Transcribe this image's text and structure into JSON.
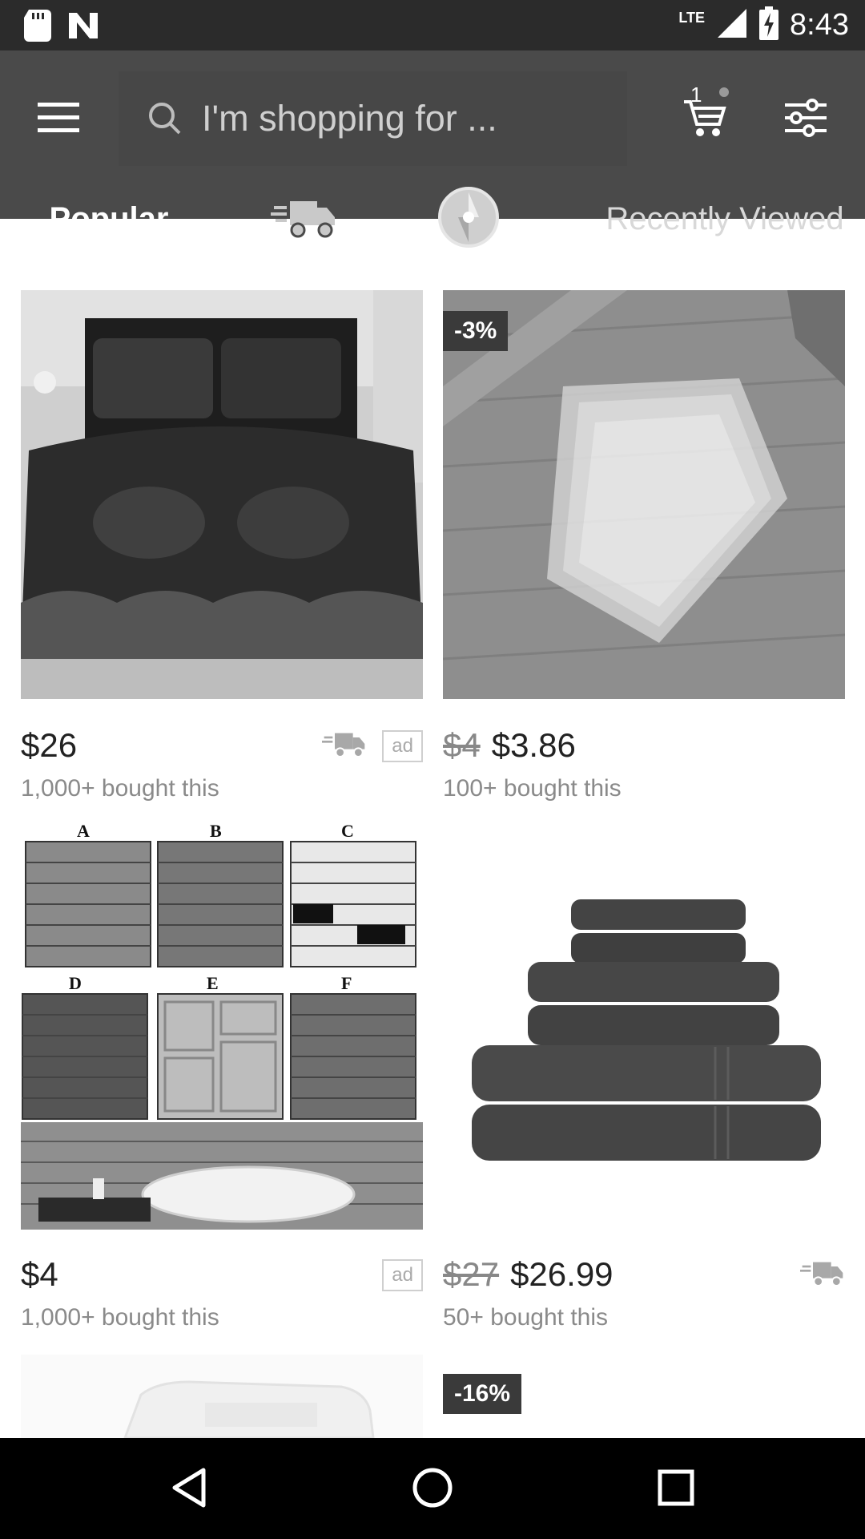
{
  "status_bar": {
    "time": "8:43",
    "network": "LTE",
    "icons": [
      "sd-card-icon",
      "n-logo-icon",
      "signal-icon",
      "battery-charging-icon"
    ]
  },
  "header": {
    "menu_icon": "menu-icon",
    "search": {
      "placeholder": "I'm shopping for ...",
      "icon": "search-icon"
    },
    "cart": {
      "count": "1",
      "icon": "cart-icon"
    },
    "filter_icon": "filter-icon"
  },
  "tabs": [
    {
      "label": "Popular",
      "selected": true
    },
    {
      "icon": "shipping-truck-icon"
    },
    {
      "icon": "deal-disc-icon"
    },
    {
      "label": "Recently Viewed"
    }
  ],
  "products": [
    {
      "name": "bedding-set",
      "price": "$26",
      "old_price": "",
      "bought": "1,000+ bought this",
      "ad": "ad",
      "fast_shipping": true,
      "discount": ""
    },
    {
      "name": "clear-bags",
      "price": "$3.86",
      "old_price": "$4",
      "bought": "100+ bought this",
      "ad": "",
      "fast_shipping": false,
      "discount": "-3%"
    },
    {
      "name": "wall-tiles",
      "price": "$4",
      "old_price": "",
      "bought": "1,000+ bought this",
      "ad": "ad",
      "fast_shipping": false,
      "discount": "",
      "tile_labels": [
        "A",
        "B",
        "C",
        "D",
        "E",
        "F"
      ]
    },
    {
      "name": "towels",
      "price": "$26.99",
      "old_price": "$27",
      "bought": "50+ bought this",
      "ad": "",
      "fast_shipping": true,
      "discount": ""
    },
    {
      "name": "next-left",
      "discount": ""
    },
    {
      "name": "next-right",
      "discount": "-16%"
    }
  ],
  "nav": {
    "back_icon": "back-icon",
    "home_icon": "home-icon",
    "recents_icon": "recents-icon"
  },
  "colors": {
    "status_bar": "#2b2b2b",
    "app_bar": "#4a4a4a",
    "nav_bar": "#000000"
  }
}
